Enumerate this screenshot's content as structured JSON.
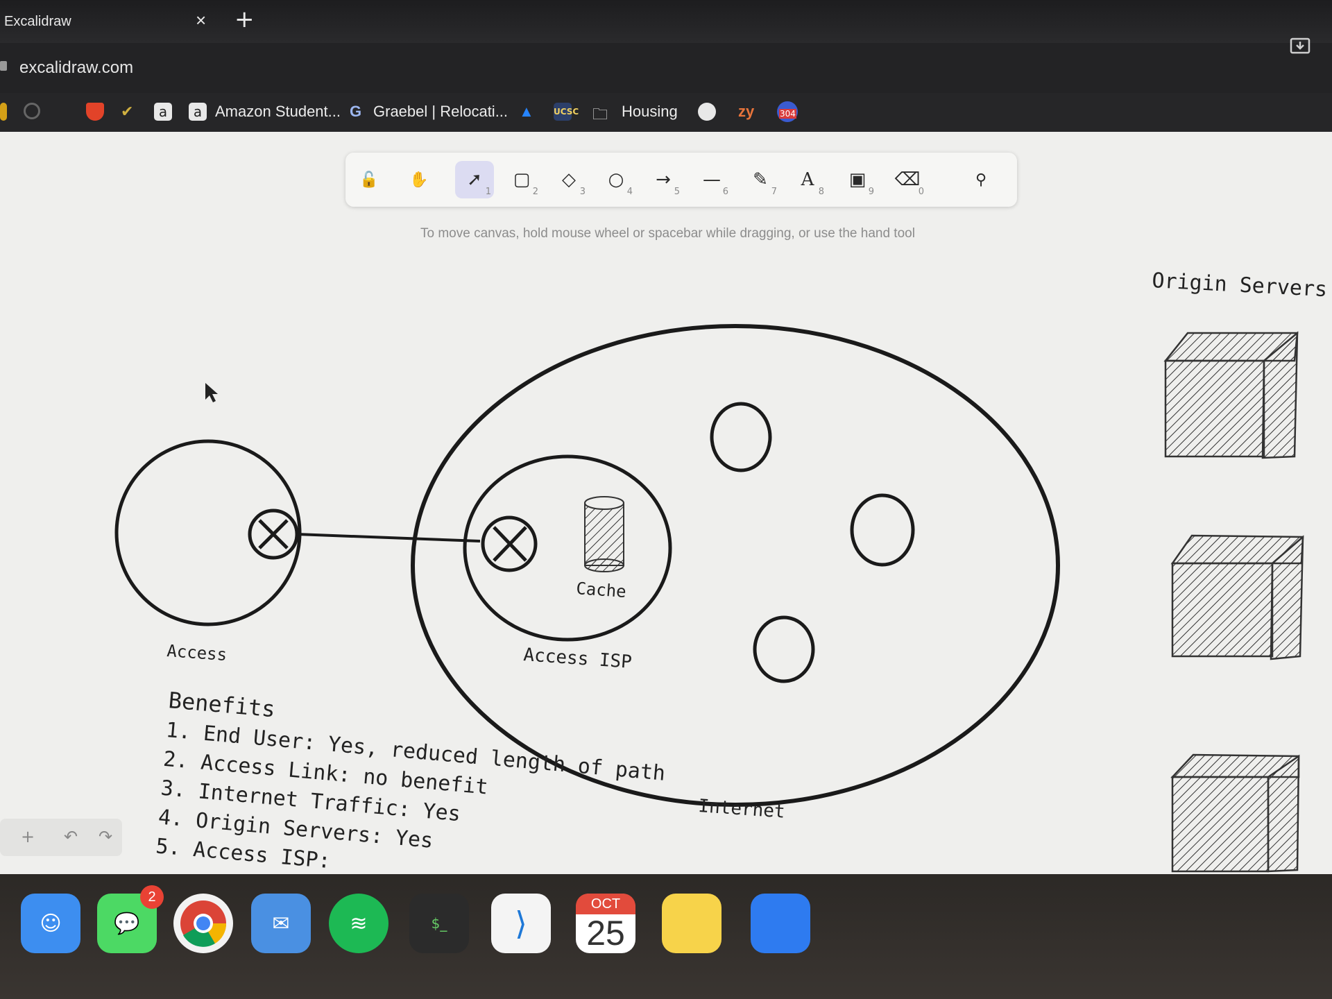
{
  "browser": {
    "tab_title": "Excalidraw",
    "tab_close": "×",
    "new_tab": "+",
    "url": "excalidraw.com",
    "bookmarks": [
      {
        "label": "Amazon Student...",
        "icon": "amazon-icon"
      },
      {
        "label": "Graebel | Relocati...",
        "icon": "google-icon"
      },
      {
        "label": "Housing",
        "icon": "folder-icon"
      },
      {
        "label": "zy",
        "icon": "zybooks-icon"
      },
      {
        "label": "304",
        "icon": "route-icon"
      }
    ]
  },
  "toolbar": {
    "tools": [
      {
        "name": "lock",
        "glyph": "🔓",
        "key": ""
      },
      {
        "name": "hand",
        "glyph": "✋",
        "key": ""
      },
      {
        "name": "selection",
        "glyph": "➚",
        "key": "1"
      },
      {
        "name": "rectangle",
        "glyph": "▢",
        "key": "2"
      },
      {
        "name": "diamond",
        "glyph": "◇",
        "key": "3"
      },
      {
        "name": "ellipse",
        "glyph": "○",
        "key": "4"
      },
      {
        "name": "arrow",
        "glyph": "→",
        "key": "5"
      },
      {
        "name": "line",
        "glyph": "—",
        "key": "6"
      },
      {
        "name": "draw",
        "glyph": "✎",
        "key": "7"
      },
      {
        "name": "text",
        "glyph": "A",
        "key": "8"
      },
      {
        "name": "image",
        "glyph": "▣",
        "key": "9"
      },
      {
        "name": "eraser",
        "glyph": "⌫",
        "key": "0"
      },
      {
        "name": "shapes",
        "glyph": "⚲",
        "key": ""
      }
    ],
    "hint": "To move canvas, hold mouse wheel or spacebar while dragging, or use the hand tool"
  },
  "drawing": {
    "origin_servers_label": "Origin Servers",
    "access_label": "Access",
    "access_isp_label": "Access ISP",
    "cache_label": "Cache",
    "internet_label": "Internet",
    "benefits_title": "Benefits",
    "benefits": [
      "1. End User: Yes, reduced length of path",
      "2. Access Link: no benefit",
      "3. Internet Traffic: Yes",
      "4. Origin Servers: Yes",
      "5. Access ISP:"
    ]
  },
  "undo_panel": {
    "zoom_in": "+",
    "undo": "↶",
    "redo": "↷"
  },
  "dock": {
    "apps": [
      {
        "name": "finder",
        "color": "#3d8ef0"
      },
      {
        "name": "messages",
        "color": "#4cd964",
        "badge": "2"
      },
      {
        "name": "chrome",
        "color": "#f2f2f2"
      },
      {
        "name": "mail",
        "color": "#4a90e2"
      },
      {
        "name": "spotify",
        "color": "#1db954"
      },
      {
        "name": "terminal",
        "color": "#2b2b2b"
      },
      {
        "name": "vscode",
        "color": "#f4f4f4"
      },
      {
        "name": "calendar",
        "color": "#ffffff"
      },
      {
        "name": "notes",
        "color": "#f7d34a"
      },
      {
        "name": "app-store",
        "color": "#2e7bf0"
      }
    ],
    "calendar_month": "OCT",
    "calendar_day": "25"
  }
}
